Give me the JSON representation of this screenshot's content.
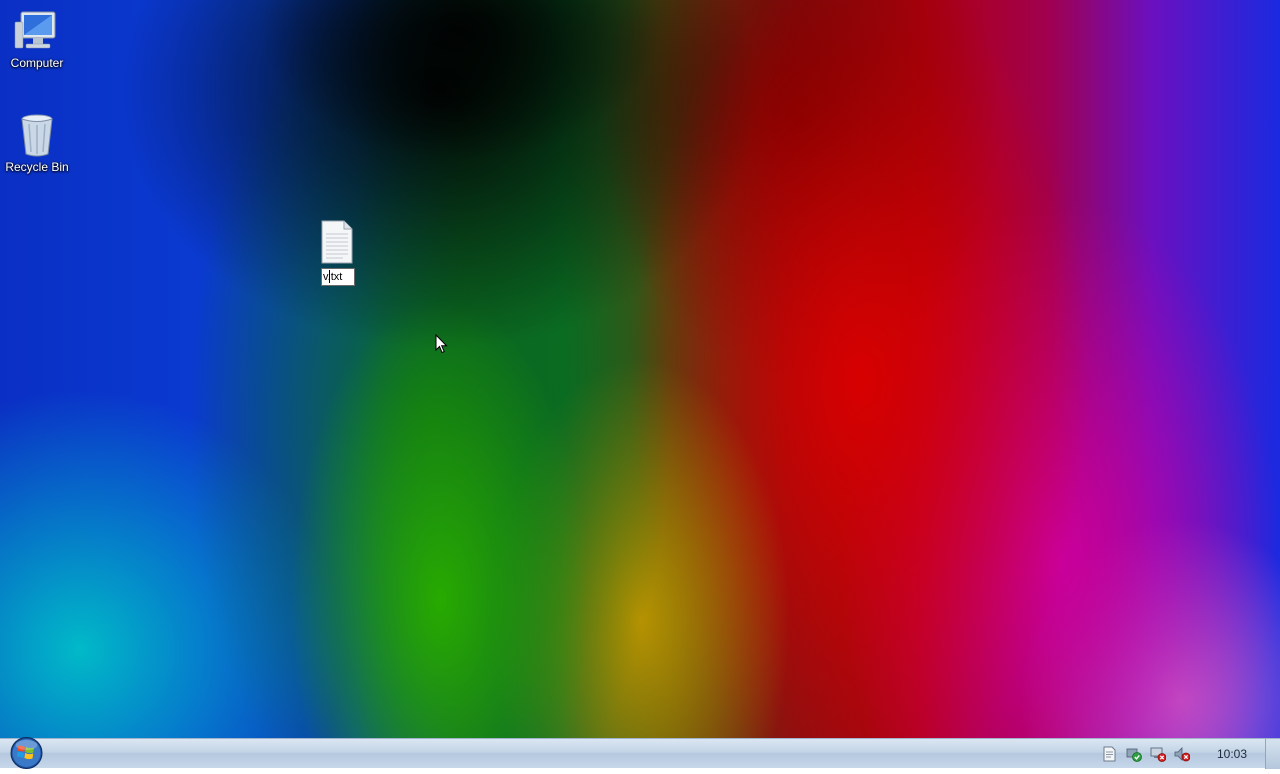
{
  "desktop": {
    "icons": [
      {
        "label": "Computer",
        "icon": "computer-icon"
      },
      {
        "label": "Recycle Bin",
        "icon": "recycle-bin-icon"
      }
    ],
    "file": {
      "icon": "text-file-icon",
      "rename_value": "v.txt"
    }
  },
  "taskbar": {
    "start_icon": "windows-orb-icon",
    "tray_icons": [
      "action-center-icon",
      "security-icon",
      "network-icon",
      "volume-muted-icon"
    ],
    "clock": "10:03"
  }
}
